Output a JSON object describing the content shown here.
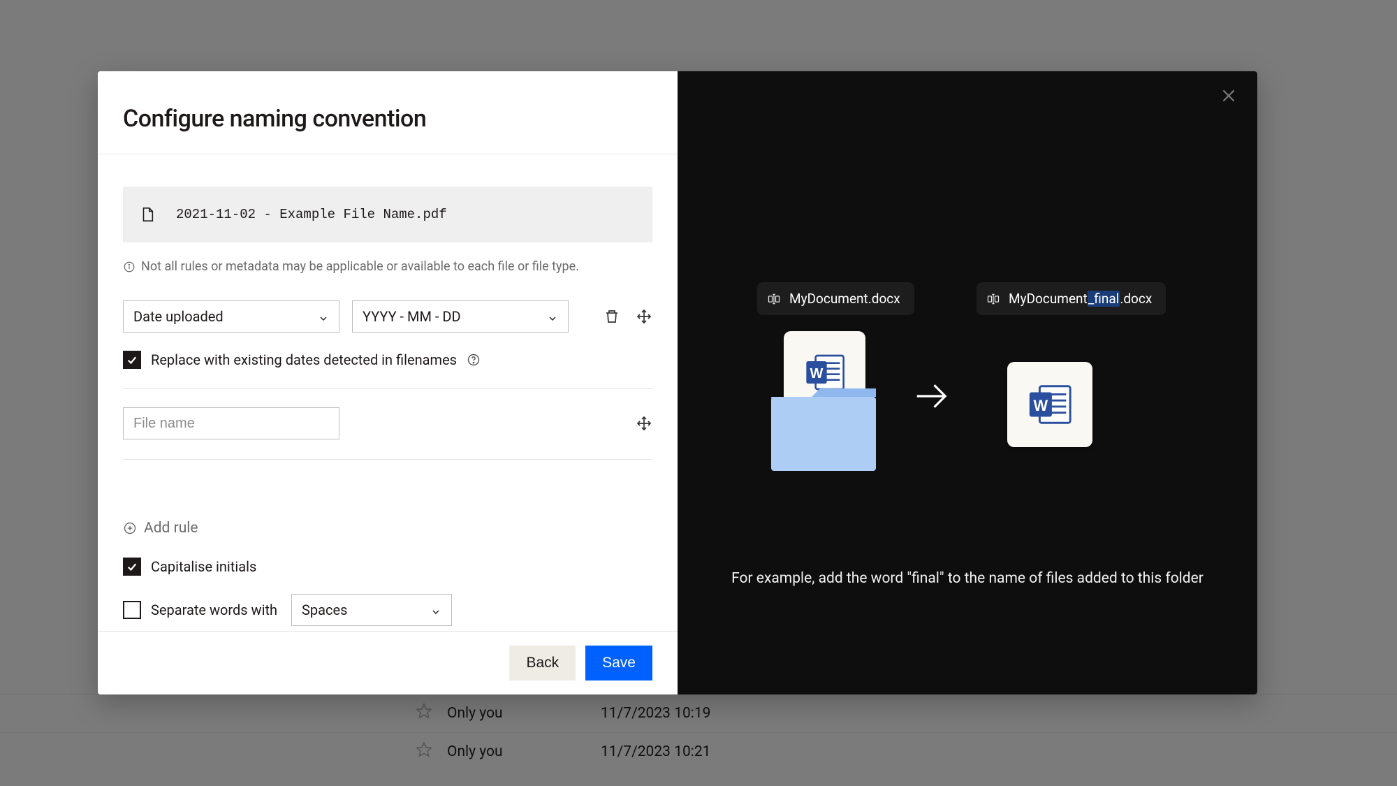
{
  "modal": {
    "title": "Configure naming convention",
    "preview_filename": "2021-11-02 - Example File Name.pdf",
    "note": "Not all rules or metadata may be applicable or available to each file or file type.",
    "rule1": {
      "field_label": "Date uploaded",
      "format_label": "YYYY - MM - DD"
    },
    "replace_dates_label": "Replace with existing dates detected in filenames",
    "filename_placeholder": "File name",
    "add_rule_label": "Add rule",
    "capitalise_label": "Capitalise initials",
    "separate_label": "Separate words with",
    "separate_selected": "Spaces",
    "back_label": "Back",
    "save_label": "Save"
  },
  "preview": {
    "before_name": "MyDocument.docx",
    "after_prefix": "MyDocument",
    "after_highlight": "_final",
    "after_suffix": ".docx",
    "caption": "For example, add the word \"final\" to the name of files added to this folder"
  },
  "background": {
    "rows": [
      {
        "who": "Only you",
        "when": "11/7/2023 10:19"
      },
      {
        "who": "Only you",
        "when": "11/7/2023 10:21"
      }
    ]
  }
}
